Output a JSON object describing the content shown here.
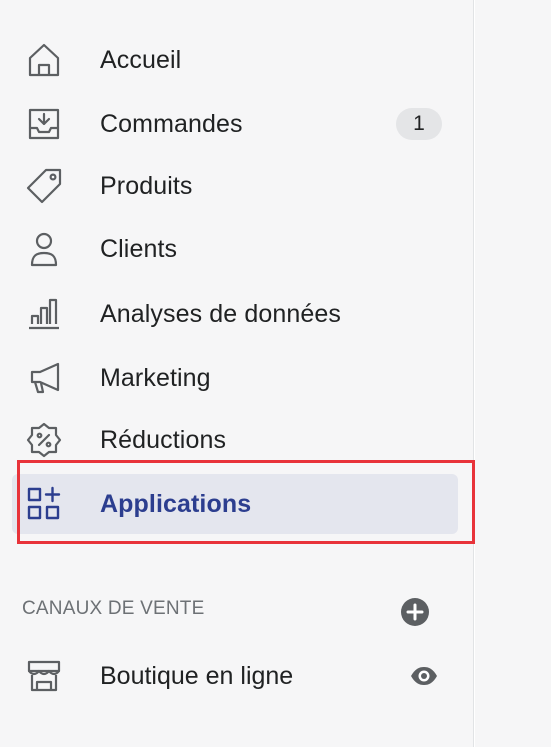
{
  "nav": {
    "items": [
      {
        "label": "Accueil",
        "icon": "home-icon"
      },
      {
        "label": "Commandes",
        "icon": "orders-icon",
        "badge": "1"
      },
      {
        "label": "Produits",
        "icon": "tag-icon"
      },
      {
        "label": "Clients",
        "icon": "person-icon"
      },
      {
        "label": "Analyses de données",
        "icon": "bar-chart-icon"
      },
      {
        "label": "Marketing",
        "icon": "megaphone-icon"
      },
      {
        "label": "Réductions",
        "icon": "discount-icon"
      },
      {
        "label": "Applications",
        "icon": "apps-icon",
        "active": true
      }
    ]
  },
  "sales_channels": {
    "title": "CANAUX DE VENTE",
    "items": [
      {
        "label": "Boutique en ligne",
        "icon": "store-icon"
      }
    ]
  },
  "colors": {
    "sidebar_bg": "#f6f6f7",
    "active_bg": "#e4e6ee",
    "active_text": "#2c3e8f",
    "highlight": "#e8333a",
    "icon_stroke": "#5c5f62"
  }
}
